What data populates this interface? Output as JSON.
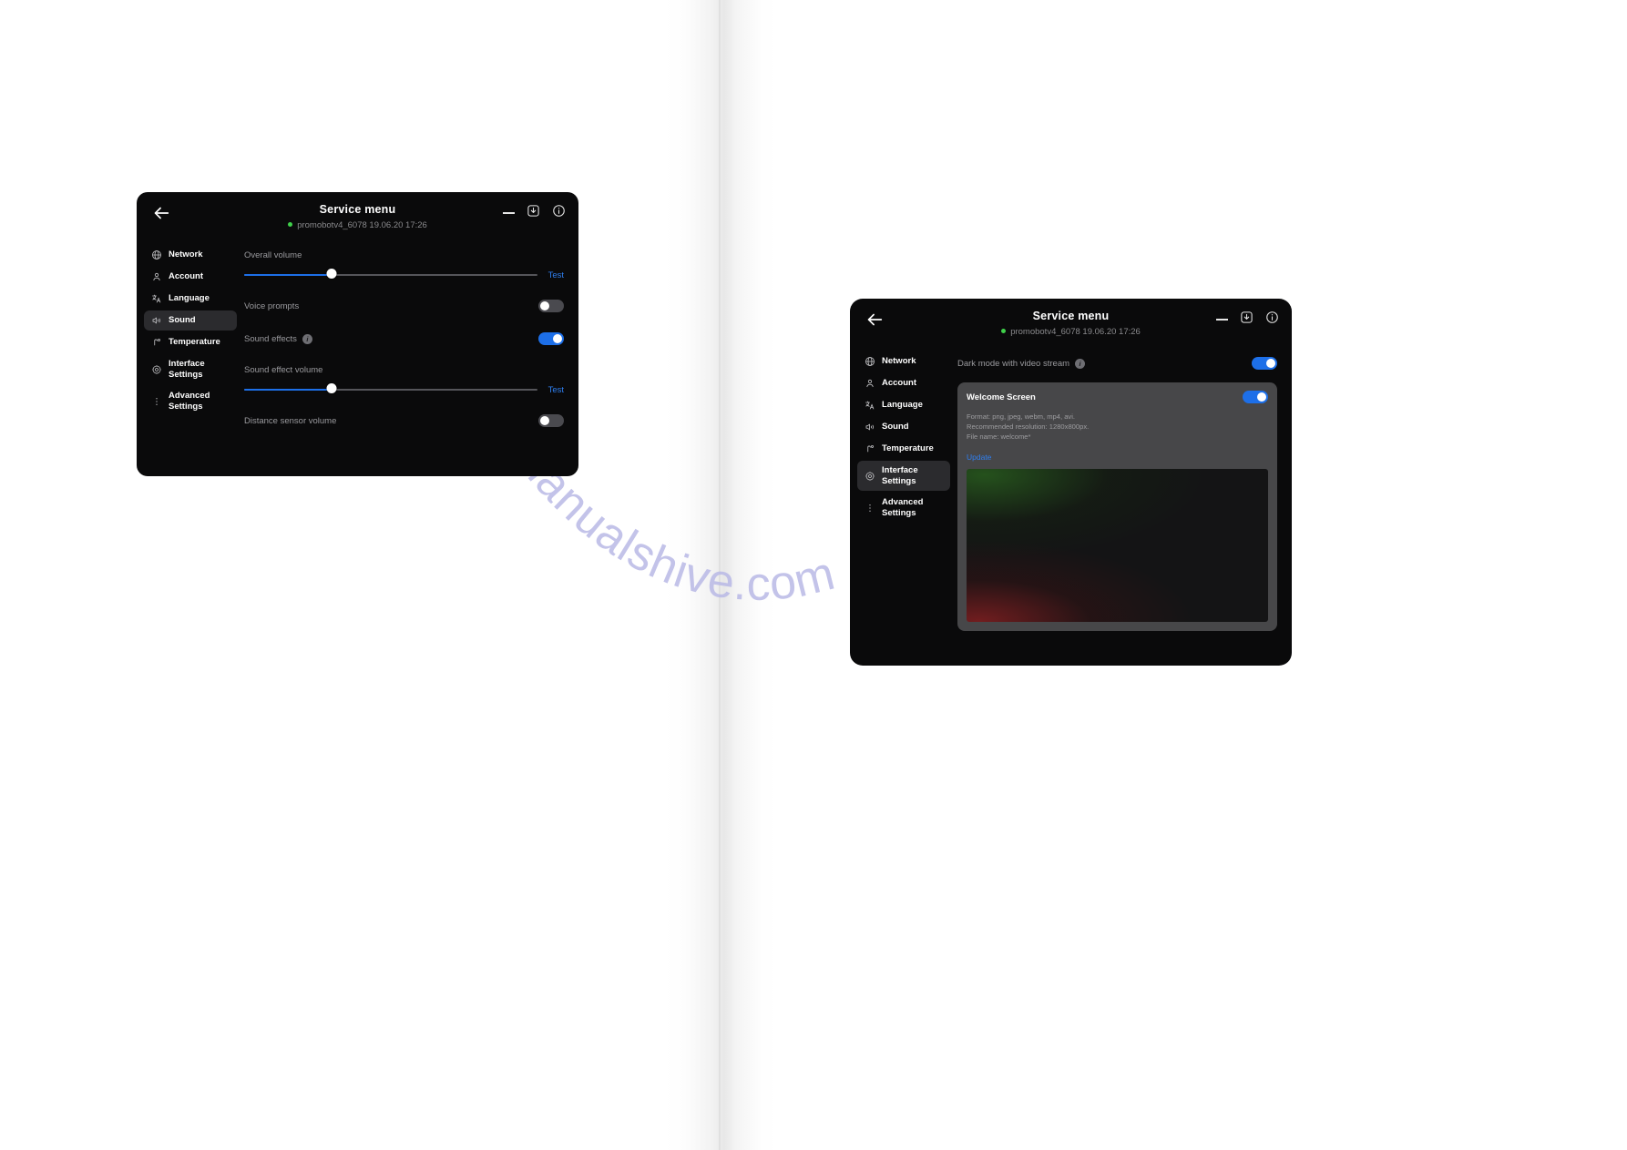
{
  "windows": {
    "left": {
      "title": "Service menu",
      "subtitle": "promobotv4_6078 19.06.20  17:26",
      "controls": {
        "back": "back-arrow",
        "minimize": "minimize",
        "download": "download",
        "info": "info"
      },
      "sidebar": {
        "items": [
          {
            "label": "Network",
            "icon": "globe-icon",
            "active": false
          },
          {
            "label": "Account",
            "icon": "user-icon",
            "active": false
          },
          {
            "label": "Language",
            "icon": "translate-icon",
            "active": false
          },
          {
            "label": "Sound",
            "icon": "speaker-icon",
            "active": true
          },
          {
            "label": "Temperature",
            "icon": "thermometer-icon",
            "active": false
          },
          {
            "label": "Interface\nSettings",
            "icon": "gear-icon",
            "active": false
          },
          {
            "label": "Advanced\nSettings",
            "icon": "dots-vertical-icon",
            "active": false
          }
        ]
      },
      "rows": {
        "overall_volume": {
          "label": "Overall volume",
          "value": 30,
          "test_label": "Test"
        },
        "voice_prompts": {
          "label": "Voice prompts",
          "state": "off"
        },
        "sound_effects": {
          "label": "Sound effects",
          "state": "on",
          "info": "i"
        },
        "sound_effect_volume": {
          "label": "Sound effect volume",
          "value": 30,
          "test_label": "Test"
        },
        "distance_sensor_volume": {
          "label": "Distance sensor volume",
          "state": "off"
        }
      }
    },
    "right": {
      "title": "Service menu",
      "subtitle": "promobotv4_6078 19.06.20  17:26",
      "sidebar": {
        "items": [
          {
            "label": "Network",
            "icon": "globe-icon",
            "active": false
          },
          {
            "label": "Account",
            "icon": "user-icon",
            "active": false
          },
          {
            "label": "Language",
            "icon": "translate-icon",
            "active": false
          },
          {
            "label": "Sound",
            "icon": "speaker-icon",
            "active": false
          },
          {
            "label": "Temperature",
            "icon": "thermometer-icon",
            "active": false
          },
          {
            "label": "Interface\nSettings",
            "icon": "gear-icon",
            "active": true
          },
          {
            "label": "Advanced\nSettings",
            "icon": "dots-vertical-icon",
            "active": false
          }
        ]
      },
      "rows": {
        "dark_mode": {
          "label": "Dark mode with video stream",
          "state": "on",
          "info": "i"
        }
      },
      "card": {
        "title": "Welcome Screen",
        "state": "on",
        "format_line": "Format: png, jpeg, webm, mp4, avi.",
        "resolution_line": "Recommended resolution: 1280x800px.",
        "filename_line": "File name: welcome*",
        "update_label": "Update"
      }
    }
  },
  "watermark": {
    "text": "manualshive.com"
  },
  "colors": {
    "accent_blue": "#1d6fe8",
    "link_blue": "#2f7ff0",
    "status_green": "#3fd04a",
    "window_bg": "#0a0a0b",
    "card_bg": "#474749"
  }
}
